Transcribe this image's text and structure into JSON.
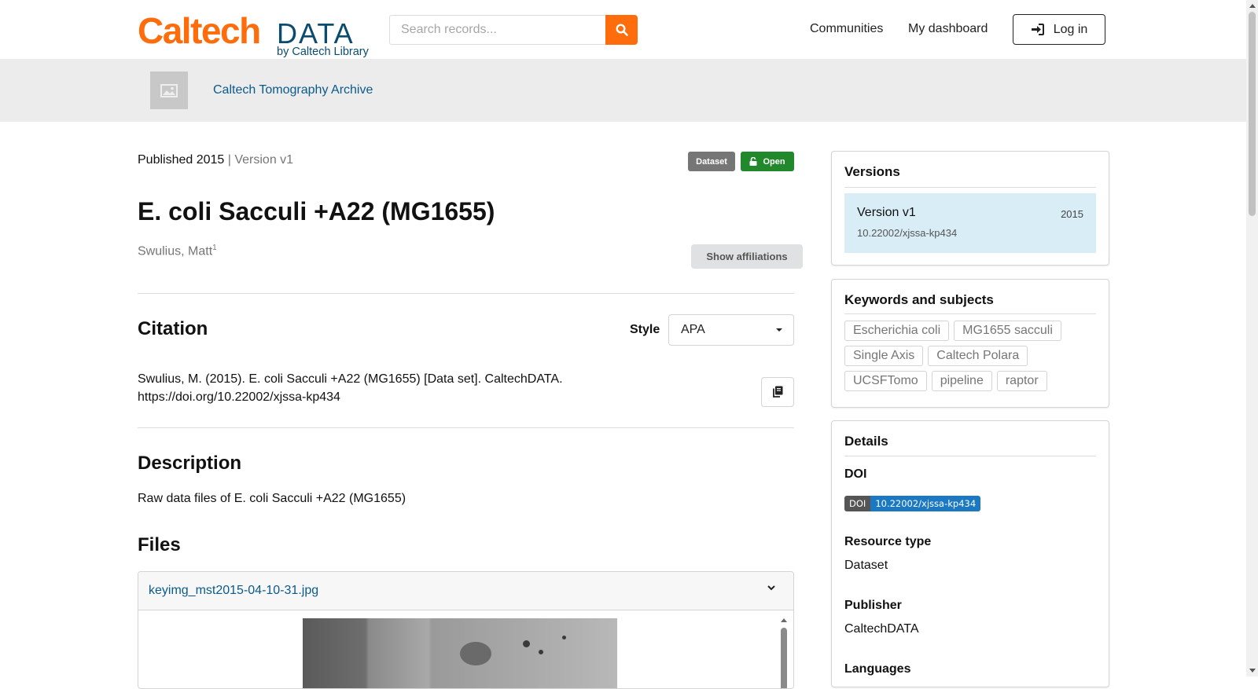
{
  "header": {
    "logo_main": "Caltech",
    "logo_data": "DATA",
    "logo_by": "by Caltech Library",
    "search_placeholder": "Search records...",
    "nav": [
      "Communities",
      "My dashboard"
    ],
    "login_label": "Log in",
    "accent_color": "#ff6c0c"
  },
  "community": {
    "name": "Caltech Tomography Archive"
  },
  "record": {
    "published": "Published 2015",
    "version_sep": " | Version v1",
    "badges": {
      "type": "Dataset",
      "access": "Open"
    },
    "title": "E. coli Sacculi +A22 (MG1655)",
    "creator": "Swulius, Matt",
    "creator_sup": "1",
    "affiliations_button": "Show affiliations"
  },
  "citation": {
    "heading": "Citation",
    "style_label": "Style",
    "style_value": "APA",
    "text": "Swulius, M. (2015). E. coli Sacculi +A22 (MG1655) [Data set]. CaltechDATA. https://doi.org/10.22002/xjssa-kp434"
  },
  "description": {
    "heading": "Description",
    "text": "Raw data files of E. coli Sacculi +A22 (MG1655)"
  },
  "files": {
    "heading": "Files",
    "file_name": "keyimg_mst2015-04-10-31.jpg"
  },
  "versions": {
    "heading": "Versions",
    "items": [
      {
        "label": "Version v1",
        "year": "2015",
        "doi": "10.22002/xjssa-kp434"
      }
    ]
  },
  "keywords": {
    "heading": "Keywords and subjects",
    "items": [
      "Escherichia coli",
      "MG1655 sacculi",
      "Single Axis",
      "Caltech Polara",
      "UCSFTomo",
      "pipeline",
      "raptor"
    ]
  },
  "details": {
    "heading": "Details",
    "doi_label": "DOI",
    "doi_badge_left": "DOI",
    "doi_badge_right": "10.22002/xjssa-kp434",
    "resource_type_label": "Resource type",
    "resource_type": "Dataset",
    "publisher_label": "Publisher",
    "publisher": "CaltechDATA",
    "languages_label": "Languages"
  }
}
